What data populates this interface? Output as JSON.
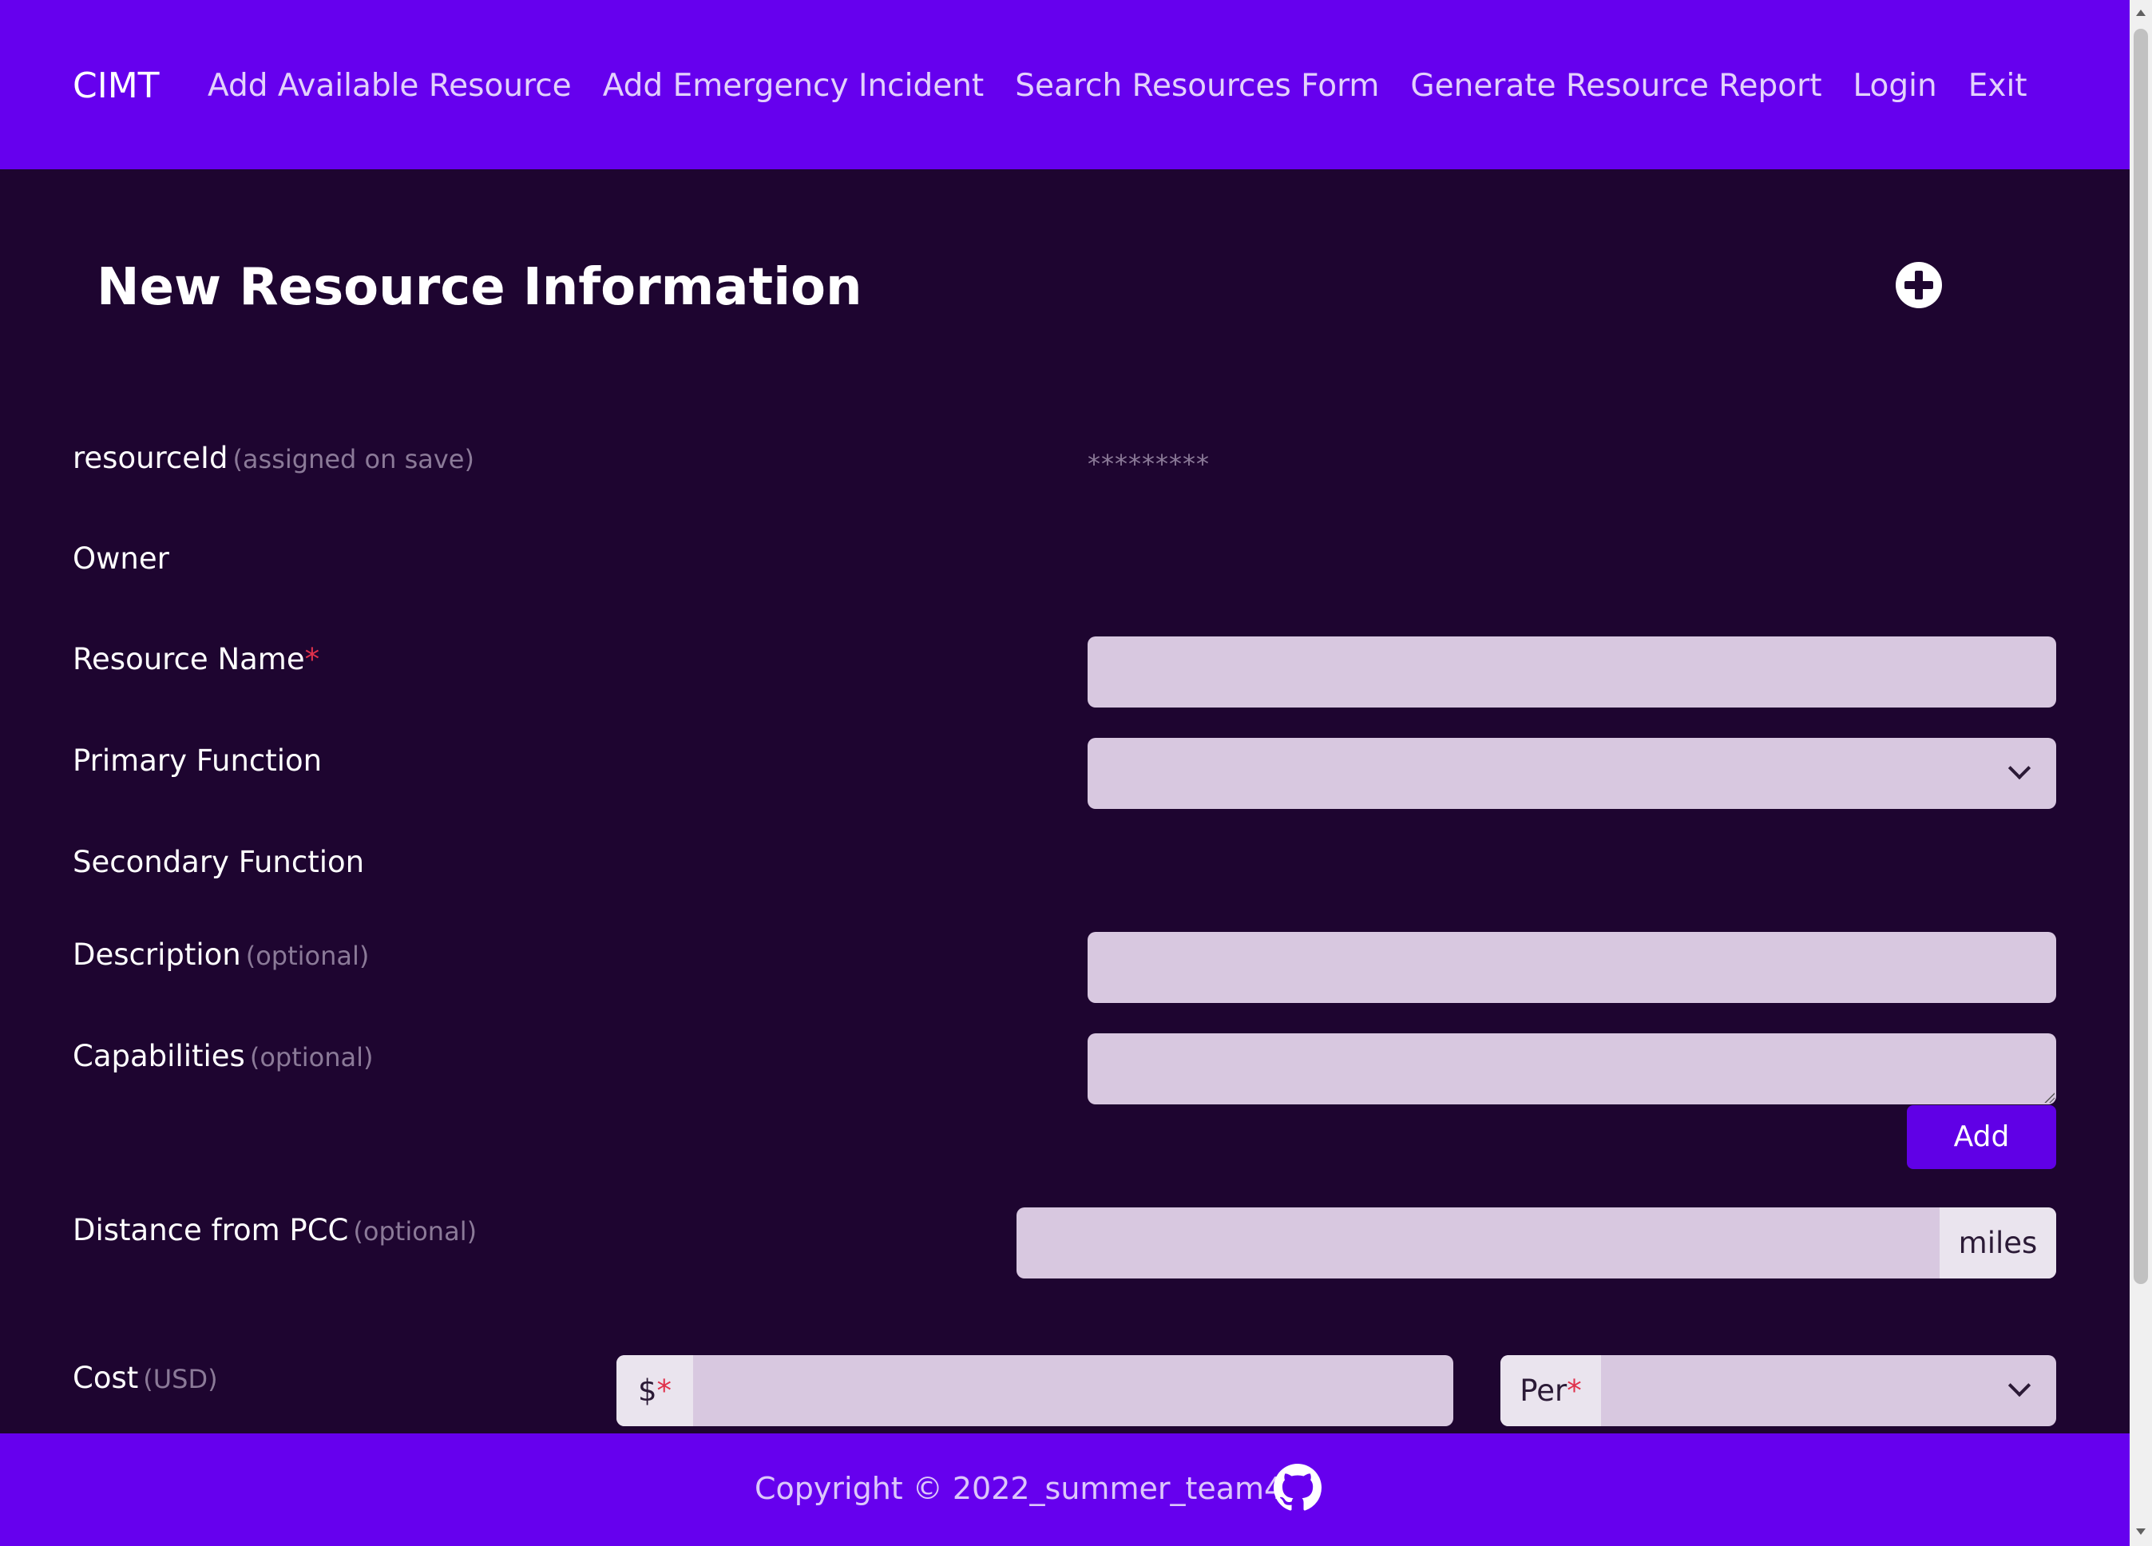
{
  "navbar": {
    "brand": "CIMT",
    "links": [
      "Add Available Resource",
      "Add Emergency Incident",
      "Search Resources Form",
      "Generate Resource Report",
      "Login",
      "Exit"
    ]
  },
  "page": {
    "title": "New Resource Information",
    "add_icon": "plus-circle-icon"
  },
  "form": {
    "resource_id": {
      "label": "resourceId",
      "hint": "(assigned on save)",
      "value": "*********"
    },
    "owner": {
      "label": "Owner"
    },
    "resource_name": {
      "label": "Resource Name",
      "required": "*",
      "value": ""
    },
    "primary_function": {
      "label": "Primary Function",
      "value": ""
    },
    "secondary_function": {
      "label": "Secondary Function"
    },
    "description": {
      "label": "Description",
      "hint": "(optional)",
      "value": ""
    },
    "capabilities": {
      "label": "Capabilities",
      "hint": "(optional)",
      "value": "",
      "add_label": "Add"
    },
    "distance": {
      "label": "Distance from PCC",
      "hint": "(optional)",
      "value": "",
      "unit": "miles"
    },
    "cost": {
      "label": "Cost",
      "hint": "(USD)",
      "prefix": "$",
      "prefix_required": "*",
      "value": "",
      "per_label": "Per",
      "per_required": "*",
      "per_value": ""
    }
  },
  "footer": {
    "copyright": "Copyright © 2022_summer_team4",
    "github_icon": "github-icon"
  },
  "colors": {
    "navbar": "#6600ee",
    "background": "#1e0530",
    "input": "#d8c8e0",
    "button": "#6000e6",
    "required": "#e0314b"
  }
}
